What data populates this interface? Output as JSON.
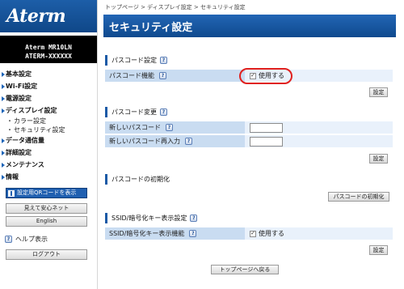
{
  "logo": "Aterm",
  "device": {
    "model": "Aterm   MR10LN",
    "id": "ATERM-XXXXXX"
  },
  "nav": {
    "items": [
      {
        "label": "基本設定"
      },
      {
        "label": "Wi-Fi設定"
      },
      {
        "label": "電源設定"
      },
      {
        "label": "ディスプレイ設定"
      }
    ],
    "subitems": [
      {
        "label": "カラー設定"
      },
      {
        "label": "セキュリティ設定"
      }
    ],
    "items2": [
      {
        "label": "データ通信量"
      },
      {
        "label": "詳細設定"
      },
      {
        "label": "メンテナンス"
      },
      {
        "label": "情報"
      }
    ],
    "qr_label": "設定用QRコードを表示",
    "mimasite_label": "見えて安心ネット",
    "english_label": "English",
    "help_label": "ヘルプ表示",
    "logout_label": "ログアウト"
  },
  "breadcrumb": "トップページ > ディスプレイ設定 > セキュリティ設定",
  "page_title": "セキュリティ設定",
  "sections": {
    "passcode": {
      "title": "パスコード設定",
      "row_label": "パスコード機能",
      "checkbox_label": "使用する",
      "checked": true,
      "button": "設定"
    },
    "change": {
      "title": "パスコード変更",
      "new_label": "新しいパスコード",
      "confirm_label": "新しいパスコード再入力",
      "new_value": "",
      "confirm_value": "",
      "button": "設定"
    },
    "init": {
      "title": "パスコードの初期化",
      "button": "パスコードの初期化"
    },
    "ssid": {
      "title": "SSID/暗号化キー表示設定",
      "row_label": "SSID/暗号化キー表示機能",
      "checkbox_label": "使用する",
      "checked": true,
      "button": "設定"
    }
  },
  "back_button": "トップページへ戻る",
  "colors": {
    "title_bar": "#1b5aa6",
    "label_cell": "#c9dcf1",
    "value_cell": "#e9f1fb",
    "highlight": "#e0201e"
  }
}
